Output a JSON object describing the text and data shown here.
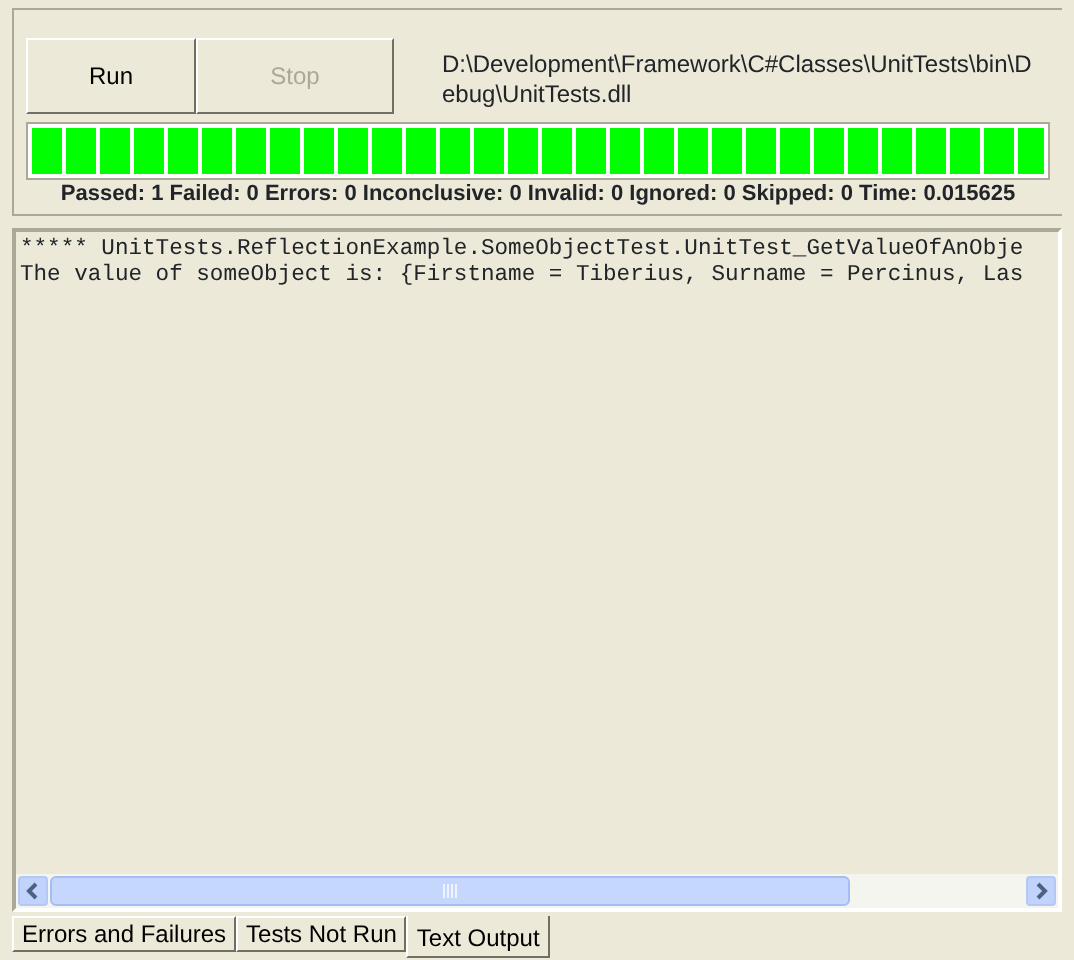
{
  "buttons": [
    {
      "label": "Run",
      "disabled": false
    },
    {
      "label": "Stop",
      "disabled": true
    }
  ],
  "assembly_path": "D:\\Development\\Framework\\C#Classes\\UnitTests\\bin\\Debug\\UnitTests.dll",
  "progress": {
    "level": 1
  },
  "summary": "Passed: 1 Failed: 0 Errors: 0 Inconclusive: 0 Invalid: 0 Ignored: 0 Skipped: 0 Time: 0.015625",
  "output_lines": [
    "***** UnitTests.ReflectionExample.SomeObjectTest.UnitTest_GetValueOfAnObje",
    "The value of someObject is: {Firstname = Tiberius, Surname = Percinus, Las"
  ],
  "tabs": [
    {
      "label": "Errors and Failures",
      "selected": false
    },
    {
      "label": "Tests Not Run",
      "selected": false
    },
    {
      "label": "Text Output",
      "selected": true
    }
  ]
}
